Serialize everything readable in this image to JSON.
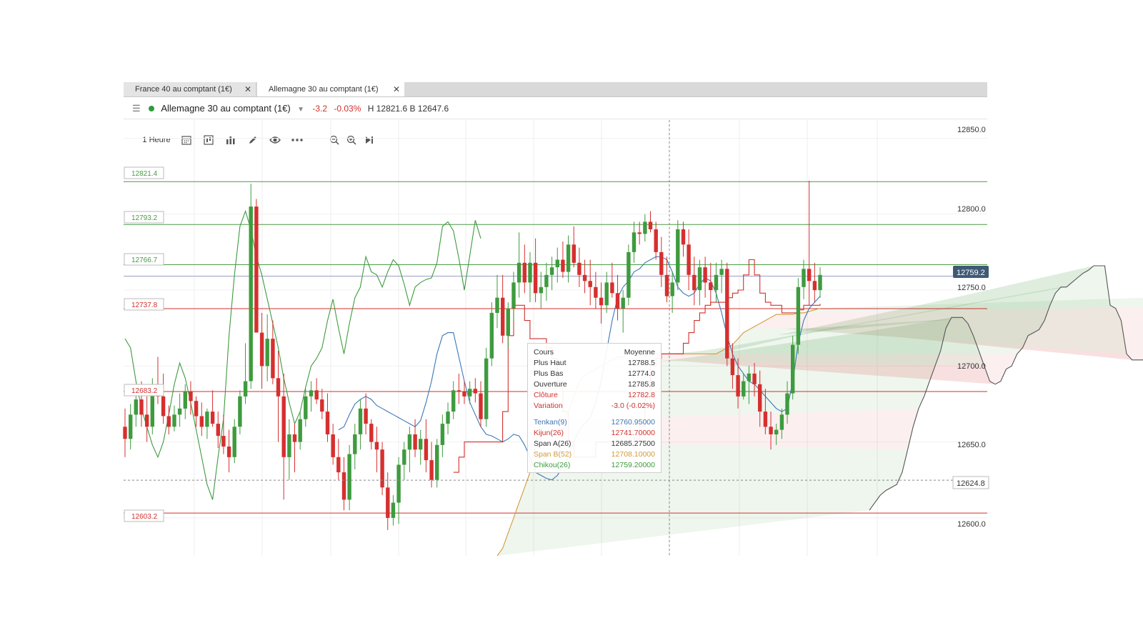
{
  "tabs": [
    {
      "label": "France 40 au comptant (1€)",
      "active": false
    },
    {
      "label": "Allemagne 30 au comptant (1€)",
      "active": true
    }
  ],
  "instrument": {
    "name": "Allemagne 30 au comptant (1€)",
    "change": "-3.2",
    "change_pct": "-0.03%",
    "high_label": "H 12821.6",
    "low_label": "B 12647.6",
    "status_color": "#2e9b3a"
  },
  "toolbar": {
    "interval_label": "1 Heure",
    "icons": [
      "calendar-icon",
      "candle-type-icon",
      "indicators-icon",
      "pencil-icon",
      "eye-icon",
      "more-icon",
      "zoom-out-icon",
      "zoom-in-icon",
      "skip-to-end-icon"
    ]
  },
  "price_axis": {
    "ticks": [
      "12850.0",
      "12800.0",
      "12750.0",
      "12700.0",
      "12650.0",
      "12600.0"
    ],
    "current_price": "12759.2",
    "crosshair_price": "12624.8"
  },
  "level_labels": [
    {
      "text": "12821.4",
      "color": "#4a9b45"
    },
    {
      "text": "12793.2",
      "color": "#4a9b45"
    },
    {
      "text": "12766.7",
      "color": "#4a9b45"
    },
    {
      "text": "12737.8",
      "color": "#d0312d"
    },
    {
      "text": "12683.2",
      "color": "#d0312d"
    },
    {
      "text": "12603.2",
      "color": "#d0312d"
    }
  ],
  "tooltip": {
    "header_left": "Cours",
    "header_right": "Moyenne",
    "rows": [
      {
        "label": "Plus Haut",
        "value": "12788.5",
        "color": "#333333"
      },
      {
        "label": "Plus Bas",
        "value": "12774.0",
        "color": "#333333"
      },
      {
        "label": "Ouverture",
        "value": "12785.8",
        "color": "#333333"
      },
      {
        "label": "Clôture",
        "value": "12782.8",
        "color": "#d0312d"
      },
      {
        "label": "Variation",
        "value": "-3.0 (-0.02%)",
        "color": "#d0312d"
      }
    ],
    "indicators": [
      {
        "label": "Tenkan(9)",
        "value": "12760.95000",
        "color": "#3b78b8"
      },
      {
        "label": "Kijun(26)",
        "value": "12741.70000",
        "color": "#d0312d"
      },
      {
        "label": "Span A(26)",
        "value": "12685.27500",
        "color": "#333333"
      },
      {
        "label": "Span B(52)",
        "value": "12708.10000",
        "color": "#d49a3a"
      },
      {
        "label": "Chikou(26)",
        "value": "12759.20000",
        "color": "#3e9b3e"
      }
    ]
  },
  "colors": {
    "up": "#3e9b3e",
    "down": "#d62f2f",
    "tenkan": "#3b78b8",
    "kijun": "#d0312d",
    "span_a": "#555555",
    "span_b": "#d49a3a",
    "chikou": "#3e9b3e"
  },
  "chart_data": {
    "type": "candlestick",
    "ylim": [
      12575,
      12862
    ],
    "y_ticks": [
      12850,
      12800,
      12750,
      12700,
      12650,
      12600
    ],
    "levels": [
      12821.4,
      12793.2,
      12766.7,
      12737.8,
      12683.2,
      12603.2
    ],
    "current_price": 12759.2,
    "crosshair_price": 12624.8,
    "candles": [
      [
        12660,
        12672,
        12640,
        12652
      ],
      [
        12652,
        12675,
        12645,
        12668
      ],
      [
        12668,
        12683,
        12660,
        12678
      ],
      [
        12678,
        12690,
        12660,
        12668
      ],
      [
        12668,
        12680,
        12650,
        12660
      ],
      [
        12660,
        12692,
        12655,
        12688
      ],
      [
        12688,
        12706,
        12675,
        12680
      ],
      [
        12680,
        12695,
        12662,
        12667
      ],
      [
        12667,
        12674,
        12655,
        12660
      ],
      [
        12660,
        12674,
        12657,
        12668
      ],
      [
        12668,
        12682,
        12660,
        12672
      ],
      [
        12672,
        12688,
        12665,
        12683
      ],
      [
        12683,
        12690,
        12668,
        12677
      ],
      [
        12677,
        12680,
        12660,
        12667
      ],
      [
        12667,
        12676,
        12654,
        12660
      ],
      [
        12660,
        12672,
        12652,
        12670
      ],
      [
        12670,
        12684,
        12660,
        12662
      ],
      [
        12662,
        12670,
        12646,
        12654
      ],
      [
        12654,
        12668,
        12642,
        12647
      ],
      [
        12647,
        12658,
        12630,
        12640
      ],
      [
        12640,
        12665,
        12636,
        12660
      ],
      [
        12660,
        12684,
        12655,
        12680
      ],
      [
        12680,
        12715,
        12675,
        12690
      ],
      [
        12690,
        12820,
        12685,
        12805
      ],
      [
        12805,
        12810,
        12735,
        12722
      ],
      [
        12722,
        12735,
        12685,
        12700
      ],
      [
        12700,
        12734,
        12690,
        12718
      ],
      [
        12718,
        12730,
        12688,
        12692
      ],
      [
        12692,
        12710,
        12650,
        12680
      ],
      [
        12680,
        12695,
        12612,
        12640
      ],
      [
        12640,
        12665,
        12625,
        12655
      ],
      [
        12655,
        12662,
        12630,
        12650
      ],
      [
        12650,
        12670,
        12645,
        12665
      ],
      [
        12665,
        12685,
        12660,
        12680
      ],
      [
        12680,
        12690,
        12670,
        12684
      ],
      [
        12684,
        12692,
        12675,
        12678
      ],
      [
        12678,
        12685,
        12665,
        12670
      ],
      [
        12670,
        12682,
        12650,
        12655
      ],
      [
        12655,
        12662,
        12635,
        12640
      ],
      [
        12640,
        12652,
        12625,
        12630
      ],
      [
        12630,
        12640,
        12605,
        12612
      ],
      [
        12612,
        12648,
        12605,
        12642
      ],
      [
        12642,
        12662,
        12632,
        12655
      ],
      [
        12655,
        12678,
        12645,
        12672
      ],
      [
        12672,
        12682,
        12655,
        12662
      ],
      [
        12662,
        12665,
        12645,
        12650
      ],
      [
        12650,
        12660,
        12630,
        12645
      ],
      [
        12645,
        12650,
        12615,
        12620
      ],
      [
        12620,
        12630,
        12592,
        12600
      ],
      [
        12600,
        12615,
        12595,
        12610
      ],
      [
        12610,
        12640,
        12596,
        12635
      ],
      [
        12635,
        12650,
        12625,
        12645
      ],
      [
        12645,
        12660,
        12630,
        12655
      ],
      [
        12655,
        12665,
        12640,
        12645
      ],
      [
        12645,
        12658,
        12635,
        12652
      ],
      [
        12652,
        12665,
        12630,
        12638
      ],
      [
        12638,
        12650,
        12620,
        12625
      ],
      [
        12625,
        12652,
        12620,
        12648
      ],
      [
        12648,
        12668,
        12640,
        12662
      ],
      [
        12662,
        12676,
        12655,
        12670
      ],
      [
        12670,
        12690,
        12665,
        12684
      ],
      [
        12684,
        12695,
        12675,
        12683
      ],
      [
        12683,
        12690,
        12675,
        12680
      ],
      [
        12680,
        12690,
        12675,
        12685
      ],
      [
        12685,
        12692,
        12676,
        12682
      ],
      [
        12682,
        12690,
        12660,
        12665
      ],
      [
        12665,
        12712,
        12660,
        12705
      ],
      [
        12705,
        12742,
        12700,
        12735
      ],
      [
        12735,
        12760,
        12725,
        12745
      ],
      [
        12745,
        12760,
        12715,
        12720
      ],
      [
        12720,
        12742,
        12712,
        12738
      ],
      [
        12738,
        12762,
        12730,
        12755
      ],
      [
        12755,
        12788,
        12745,
        12768
      ],
      [
        12768,
        12780,
        12748,
        12755
      ],
      [
        12755,
        12775,
        12742,
        12768
      ],
      [
        12768,
        12784,
        12742,
        12748
      ],
      [
        12748,
        12762,
        12738,
        12752
      ],
      [
        12752,
        12768,
        12743,
        12760
      ],
      [
        12760,
        12772,
        12750,
        12765
      ],
      [
        12765,
        12778,
        12755,
        12770
      ],
      [
        12770,
        12782,
        12758,
        12762
      ],
      [
        12762,
        12786,
        12755,
        12780
      ],
      [
        12780,
        12792,
        12765,
        12768
      ],
      [
        12768,
        12778,
        12752,
        12760
      ],
      [
        12760,
        12770,
        12748,
        12756
      ],
      [
        12756,
        12770,
        12740,
        12752
      ],
      [
        12752,
        12762,
        12738,
        12745
      ],
      [
        12745,
        12755,
        12728,
        12740
      ],
      [
        12740,
        12762,
        12735,
        12755
      ],
      [
        12755,
        12768,
        12745,
        12748
      ],
      [
        12748,
        12760,
        12730,
        12738
      ],
      [
        12738,
        12750,
        12722,
        12745
      ],
      [
        12745,
        12780,
        12740,
        12775
      ],
      [
        12775,
        12795,
        12768,
        12788
      ],
      [
        12788,
        12795,
        12780,
        12787
      ],
      [
        12787,
        12800,
        12782,
        12795
      ],
      [
        12795,
        12802,
        12788,
        12790
      ],
      [
        12790,
        12795,
        12770,
        12775
      ],
      [
        12775,
        12785,
        12752,
        12760
      ],
      [
        12760,
        12772,
        12742,
        12746
      ],
      [
        12746,
        12762,
        12735,
        12755
      ],
      [
        12755,
        12796,
        12750,
        12790
      ],
      [
        12790,
        12795,
        12772,
        12780
      ],
      [
        12780,
        12790,
        12750,
        12760
      ],
      [
        12760,
        12772,
        12740,
        12750
      ],
      [
        12750,
        12770,
        12740,
        12765
      ],
      [
        12765,
        12772,
        12745,
        12755
      ],
      [
        12755,
        12768,
        12740,
        12750
      ],
      [
        12750,
        12768,
        12742,
        12760
      ],
      [
        12760,
        12770,
        12748,
        12764
      ],
      [
        12764,
        12768,
        12700,
        12705
      ],
      [
        12705,
        12715,
        12685,
        12694
      ],
      [
        12694,
        12705,
        12672,
        12680
      ],
      [
        12680,
        12695,
        12678,
        12690
      ],
      [
        12690,
        12700,
        12675,
        12695
      ],
      [
        12695,
        12702,
        12680,
        12688
      ],
      [
        12688,
        12697,
        12660,
        12670
      ],
      [
        12670,
        12685,
        12655,
        12660
      ],
      [
        12660,
        12670,
        12645,
        12655
      ],
      [
        12655,
        12662,
        12648,
        12658
      ],
      [
        12658,
        12672,
        12652,
        12668
      ],
      [
        12668,
        12690,
        12662,
        12682
      ],
      [
        12682,
        12720,
        12678,
        12714
      ],
      [
        12714,
        12758,
        12708,
        12752
      ],
      [
        12752,
        12770,
        12744,
        12764
      ],
      [
        12764,
        12822,
        12740,
        12756
      ],
      [
        12756,
        12768,
        12742,
        12750
      ],
      [
        12750,
        12765,
        12745,
        12760
      ]
    ],
    "chikou": [
      12718,
      12712,
      12690,
      12672,
      12660,
      12648,
      12640,
      12650,
      12668,
      12688,
      12702,
      12692,
      12676,
      12658,
      12640,
      12622,
      12612,
      12640,
      12665,
      12720,
      12760,
      12792,
      12802,
      12790,
      12772,
      12760,
      12744,
      12728,
      12712,
      12692,
      12676,
      12662,
      12670,
      12686,
      12700,
      12705,
      12712,
      12730,
      12744,
      12725,
      12708,
      12728,
      12745,
      12752,
      12772,
      12762,
      12760,
      12752,
      12762,
      12770,
      12766,
      12754,
      12740,
      12752,
      12755,
      12757,
      12758,
      12768,
      12792,
      12795,
      12789,
      12771,
      12750,
      12773,
      12796,
      12784
    ],
    "tenkan": [
      12658,
      12660,
      12668,
      12675,
      12678,
      12680,
      12678,
      12674,
      12672,
      12670,
      12668,
      12666,
      12664,
      12662,
      12660,
      12664,
      12676,
      12690,
      12708,
      12720,
      12722,
      12722,
      12706,
      12690,
      12676,
      12668,
      12660,
      12655,
      12654,
      12652,
      12650,
      12652,
      12655,
      12654,
      12648,
      12640,
      12630,
      12628,
      12626,
      12625,
      12628,
      12634,
      12640,
      12650,
      12658,
      12662,
      12666,
      12676,
      12690,
      12710,
      12730,
      12745,
      12752,
      12756,
      12762,
      12764,
      12768,
      12770,
      12772,
      12772,
      12770,
      12762,
      12752,
      12748,
      12746,
      12748,
      12754,
      12758,
      12756,
      12748,
      12735,
      12720,
      12708,
      12700,
      12695,
      12690,
      12688,
      12684,
      12680,
      12676,
      12672,
      12670,
      12672,
      12690,
      12715,
      12730,
      12738,
      12742,
      12746
    ],
    "kijun": [
      12630,
      12640,
      12650,
      12650,
      12650,
      12650,
      12650,
      12650,
      12650,
      12670,
      12720,
      12740,
      12740,
      12730,
      12718,
      12718,
      12718,
      12712,
      12705,
      12690,
      12670,
      12650,
      12640,
      12640,
      12640,
      12640,
      12650,
      12650,
      12650,
      12650,
      12650,
      12650,
      12650,
      12652,
      12660,
      12680,
      12700,
      12705,
      12708,
      12708,
      12708,
      12708,
      12715,
      12722,
      12730,
      12735,
      12740,
      12742,
      12742,
      12742,
      12745,
      12748,
      12750,
      12760,
      12770,
      12760,
      12748,
      12742,
      12740,
      12740,
      12735,
      12735,
      12735,
      12737,
      12740,
      12740,
      12740,
      12741
    ],
    "span_a": [
      12605,
      12610,
      12615,
      12618,
      12620,
      12622,
      12630,
      12645,
      12660,
      12672,
      12680,
      12690,
      12700,
      12710,
      12725,
      12732,
      12732,
      12732,
      12728,
      12720,
      12710,
      12700,
      12690,
      12688,
      12690,
      12698,
      12700,
      12708,
      12712,
      12720,
      12722,
      12724,
      12730,
      12740,
      12748,
      12752,
      12752,
      12755,
      12758,
      12761,
      12763,
      12766,
      12766,
      12766,
      12740,
      12738,
      12730,
      12708,
      12704,
      12704,
      12704,
      12712,
      12718,
      12724,
      12733,
      12739,
      12742,
      12744,
      12745,
      12746
    ],
    "span_b": [
      12575,
      12580,
      12590,
      12600,
      12610,
      12620,
      12630,
      12650,
      12664,
      12664,
      12664,
      12664,
      12664,
      12670,
      12680,
      12690,
      12694,
      12696,
      12698,
      12700,
      12702,
      12704,
      12706,
      12706,
      12708,
      12708,
      12708,
      12708,
      12708,
      12708,
      12708,
      12708,
      12708,
      12708,
      12708,
      12708,
      12708,
      12708,
      12708,
      12708,
      12708,
      12710,
      12712,
      12714,
      12718,
      12722,
      12724,
      12726,
      12728,
      12730,
      12732,
      12734,
      12734,
      12734,
      12734,
      12735,
      12735,
      12736,
      12737,
      12738
    ]
  }
}
